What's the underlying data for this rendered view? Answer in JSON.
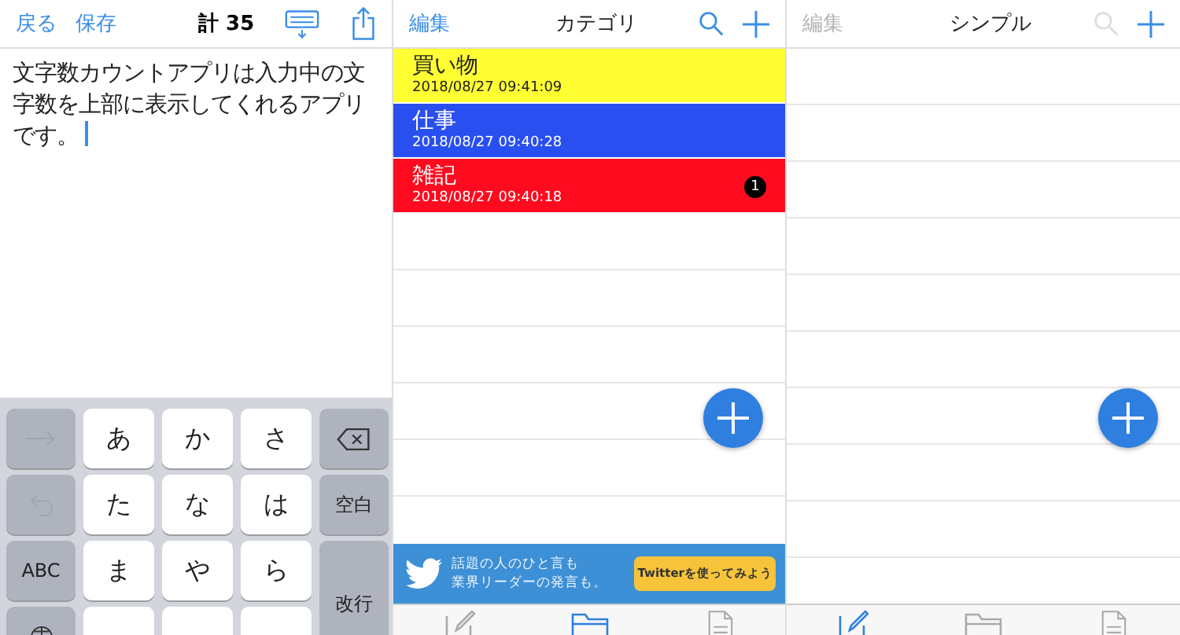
{
  "editor": {
    "nav": {
      "back": "戻る",
      "save": "保存",
      "count": "計 35"
    },
    "text": "文字数カウントアプリは入力中の文字数を上部に表示してくれるアプリです。",
    "keyboard": [
      {
        "kind": "arrow"
      },
      {
        "kind": "char",
        "label": "あ"
      },
      {
        "kind": "char",
        "label": "か"
      },
      {
        "kind": "char",
        "label": "さ"
      },
      {
        "kind": "delete"
      },
      {
        "kind": "undo"
      },
      {
        "kind": "char",
        "label": "た"
      },
      {
        "kind": "char",
        "label": "な"
      },
      {
        "kind": "char",
        "label": "は"
      },
      {
        "kind": "func",
        "label": "空白"
      },
      {
        "kind": "func",
        "label": "ABC"
      },
      {
        "kind": "char",
        "label": "ま"
      },
      {
        "kind": "char",
        "label": "や"
      },
      {
        "kind": "char",
        "label": "ら"
      },
      {
        "kind": "enter",
        "label": "改行"
      },
      {
        "kind": "globe"
      },
      {
        "kind": "blank"
      },
      {
        "kind": "blank"
      },
      {
        "kind": "blank"
      }
    ]
  },
  "category_screen": {
    "nav": {
      "edit": "編集",
      "title": "カテゴリ",
      "disabled": false
    },
    "categories": [
      {
        "name": "買い物",
        "date": "2018/08/27 09:41:09",
        "color": "#ffff33",
        "dark_text": true
      },
      {
        "name": "仕事",
        "date": "2018/08/27 09:40:28",
        "color": "#2a4ff0",
        "dark_text": false
      },
      {
        "name": "雑記",
        "date": "2018/08/27 09:40:18",
        "color": "#ff0a1e",
        "dark_text": false,
        "badge": "1"
      }
    ],
    "ad": {
      "lines": [
        "話題の人のひと言も",
        "業界リーダーの発言も。"
      ],
      "button": "Twitterを使ってみよう"
    },
    "tabs": [
      {
        "selected": false
      },
      {
        "selected": true
      },
      {
        "selected": false
      }
    ]
  },
  "simple_screen": {
    "nav": {
      "edit": "編集",
      "title": "シンプル",
      "disabled": true
    },
    "tabs": [
      {
        "selected": true
      },
      {
        "selected": false
      },
      {
        "selected": false
      }
    ]
  }
}
